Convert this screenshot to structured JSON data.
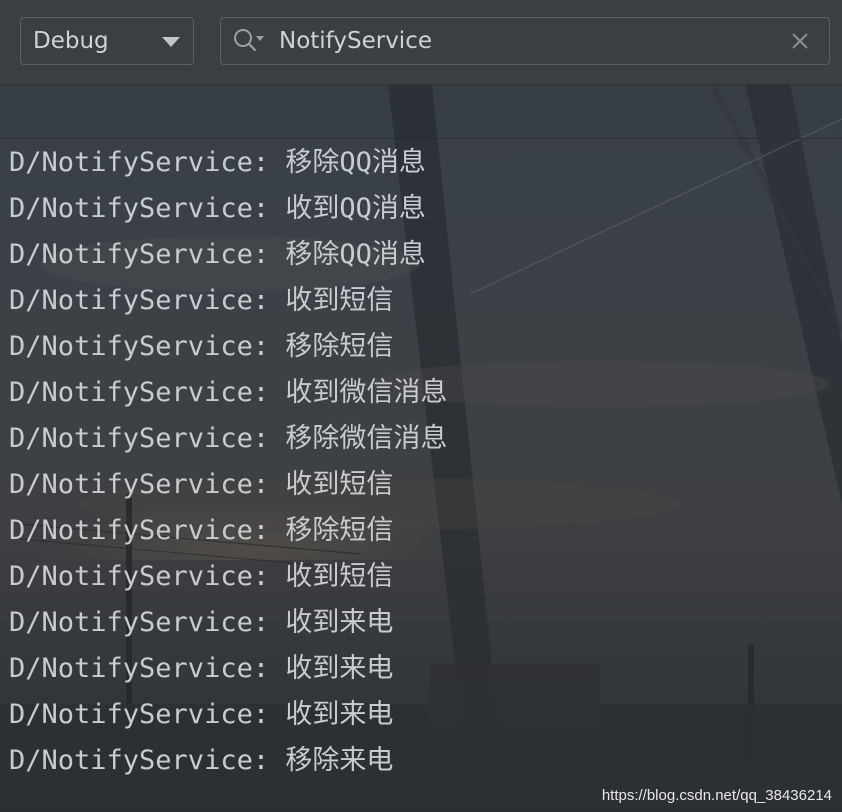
{
  "toolbar": {
    "log_level": "Debug",
    "search_value": "NotifyService",
    "search_icon": "search-icon",
    "clear_icon": "close-icon",
    "dropdown_icon": "chevron-down-icon"
  },
  "log": {
    "lines": [
      {
        "tag": "D/NotifyService:",
        "message": "移除QQ消息"
      },
      {
        "tag": "D/NotifyService:",
        "message": "收到QQ消息"
      },
      {
        "tag": "D/NotifyService:",
        "message": "移除QQ消息"
      },
      {
        "tag": "D/NotifyService:",
        "message": "收到短信"
      },
      {
        "tag": "D/NotifyService:",
        "message": "移除短信"
      },
      {
        "tag": "D/NotifyService:",
        "message": "收到微信消息"
      },
      {
        "tag": "D/NotifyService:",
        "message": "移除微信消息"
      },
      {
        "tag": "D/NotifyService:",
        "message": "收到短信"
      },
      {
        "tag": "D/NotifyService:",
        "message": "移除短信"
      },
      {
        "tag": "D/NotifyService:",
        "message": "收到短信"
      },
      {
        "tag": "D/NotifyService:",
        "message": "收到来电"
      },
      {
        "tag": "D/NotifyService:",
        "message": "收到来电"
      },
      {
        "tag": "D/NotifyService:",
        "message": "收到来电"
      },
      {
        "tag": "D/NotifyService:",
        "message": "移除来电"
      }
    ]
  },
  "watermark": "https://blog.csdn.net/qq_38436214",
  "colors": {
    "toolbar_bg": "#3c3f41",
    "border": "#5e6060",
    "text": "#c9cbce"
  }
}
